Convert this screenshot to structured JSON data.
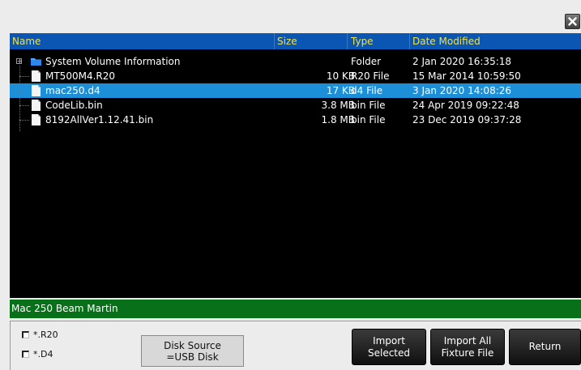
{
  "window": {
    "close_icon": "close-icon"
  },
  "file_list": {
    "columns": [
      "Name",
      "Size",
      "Type",
      "Date Modified"
    ],
    "rows": [
      {
        "name": "System Volume Information",
        "size": "",
        "type": "Folder",
        "date": "2 Jan 2020 16:35:18",
        "icon": "folder-icon",
        "expand": "+",
        "selected": false
      },
      {
        "name": "MT500M4.R20",
        "size": "10 KB",
        "type": "R20 File",
        "date": "15 Mar 2014 10:59:50",
        "icon": "file-icon",
        "selected": false
      },
      {
        "name": "mac250.d4",
        "size": "17 KB",
        "type": "d4 File",
        "date": "3 Jan 2020 14:08:26",
        "icon": "file-icon",
        "selected": true
      },
      {
        "name": "CodeLib.bin",
        "size": "3.8 MB",
        "type": "bin File",
        "date": "24 Apr 2019 09:22:48",
        "icon": "file-icon",
        "selected": false
      },
      {
        "name": "8192AllVer1.12.41.bin",
        "size": "1.8 MB",
        "type": "bin File",
        "date": "23 Dec 2019 09:37:28",
        "icon": "file-icon",
        "selected": false
      }
    ]
  },
  "status": {
    "text": "Mac 250 Beam Martin"
  },
  "filters": [
    {
      "label": "*.R20",
      "checked": false
    },
    {
      "label": "*.D4",
      "checked": false
    }
  ],
  "buttons": {
    "disk_source_line1": "Disk Source",
    "disk_source_line2": "=USB Disk",
    "import_selected_line1": "Import",
    "import_selected_line2": "Selected",
    "import_all_line1": "Import All",
    "import_all_line2": "Fixture File",
    "return": "Return"
  },
  "colors": {
    "header_bg": "#0b56b2",
    "header_text": "#f2e24a",
    "selected_row": "#1d8fd8",
    "status_bar": "#087018",
    "list_bg": "#000000"
  }
}
